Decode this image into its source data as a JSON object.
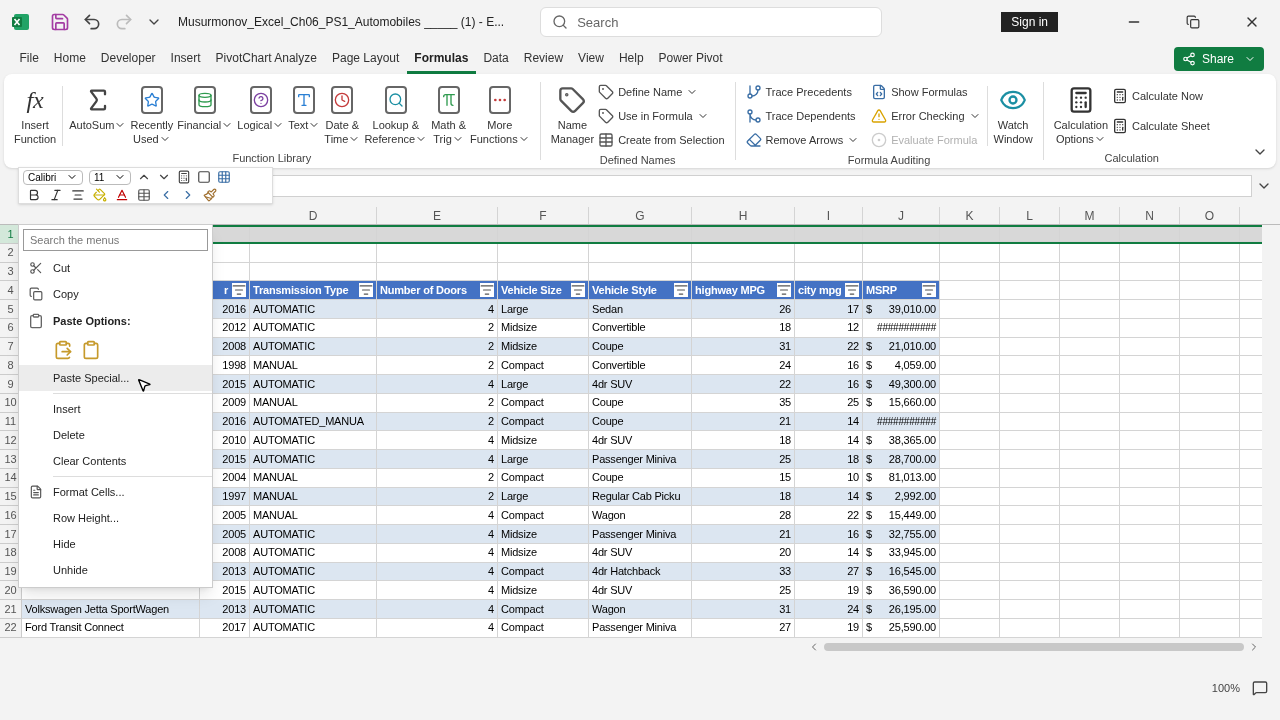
{
  "title_bar": {
    "file_title": "Musurmonov_Excel_Ch06_PS1_Automobiles _____ (1)  -  E...",
    "search_placeholder": "Search",
    "sign_in": "Sign in"
  },
  "menu_tabs": [
    {
      "label": "File",
      "selected": false
    },
    {
      "label": "Home",
      "selected": false
    },
    {
      "label": "Developer",
      "selected": false
    },
    {
      "label": "Insert",
      "selected": false
    },
    {
      "label": "PivotChart Analyze",
      "selected": false
    },
    {
      "label": "Page Layout",
      "selected": false
    },
    {
      "label": "Formulas",
      "selected": true
    },
    {
      "label": "Data",
      "selected": false
    },
    {
      "label": "Review",
      "selected": false
    },
    {
      "label": "View",
      "selected": false
    },
    {
      "label": "Help",
      "selected": false
    },
    {
      "label": "Power Pivot",
      "selected": false
    }
  ],
  "share": "Share",
  "function_library": {
    "label": "Function Library",
    "insert_function": {
      "icon_text": "fx",
      "lines": [
        "Insert",
        "Function"
      ]
    },
    "items": [
      {
        "lines": [
          "AutoSum"
        ],
        "has_menu": true
      },
      {
        "lines": [
          "Recently",
          "Used"
        ],
        "has_menu": true
      },
      {
        "lines": [
          "Financial"
        ],
        "has_menu": true
      },
      {
        "lines": [
          "Logical"
        ],
        "has_menu": true
      },
      {
        "lines": [
          "Text"
        ],
        "has_menu": true
      },
      {
        "lines": [
          "Date &",
          "Time"
        ],
        "has_menu": true
      },
      {
        "lines": [
          "Lookup &",
          "Reference"
        ],
        "has_menu": true
      },
      {
        "lines": [
          "Math &",
          "Trig"
        ],
        "has_menu": true
      },
      {
        "lines": [
          "More",
          "Functions"
        ],
        "has_menu": true
      }
    ]
  },
  "defined_names": {
    "label": "Defined Names",
    "big": {
      "lines": [
        "Name",
        "Manager"
      ]
    },
    "items": [
      {
        "label": "Define Name",
        "has_menu": true,
        "disabled": false
      },
      {
        "label": "Use in Formula",
        "has_menu": true,
        "disabled": false
      },
      {
        "label": "Create from Selection",
        "has_menu": false,
        "disabled": false
      }
    ]
  },
  "formula_auditing": {
    "label": "Formula Auditing",
    "items": [
      {
        "label": "Trace Precedents",
        "has_menu": false,
        "disabled": false
      },
      {
        "label": "Trace Dependents",
        "has_menu": false,
        "disabled": false
      },
      {
        "label": "Remove Arrows",
        "has_menu": true,
        "disabled": false
      },
      {
        "label": "Show Formulas",
        "has_menu": false,
        "disabled": false
      },
      {
        "label": "Error Checking",
        "has_menu": true,
        "disabled": false
      },
      {
        "label": "Evaluate Formula",
        "has_menu": false,
        "disabled": true
      }
    ],
    "watch": {
      "lines": [
        "Watch",
        "Window"
      ]
    }
  },
  "calculation": {
    "label": "Calculation",
    "big": {
      "lines": [
        "Calculation",
        "Options"
      ],
      "has_menu": true
    },
    "items": [
      {
        "label": "Calculate Now"
      },
      {
        "label": "Calculate Sheet"
      }
    ]
  },
  "mini_toolbar": {
    "font": "Calibri",
    "size": "11"
  },
  "context_menu": {
    "search_placeholder": "Search the menus",
    "items": [
      {
        "kind": "item",
        "label": "Cut",
        "highlighted": false
      },
      {
        "kind": "item",
        "label": "Copy",
        "highlighted": false
      },
      {
        "kind": "header",
        "label": "Paste Options:"
      },
      {
        "kind": "paste_icons"
      },
      {
        "kind": "item",
        "label": "Paste Special...",
        "highlighted": true
      },
      {
        "kind": "separator"
      },
      {
        "kind": "item",
        "label": "Insert",
        "highlighted": false
      },
      {
        "kind": "item",
        "label": "Delete",
        "highlighted": false
      },
      {
        "kind": "item",
        "label": "Clear Contents",
        "highlighted": false
      },
      {
        "kind": "separator"
      },
      {
        "kind": "item",
        "label": "Format Cells...",
        "highlighted": false
      },
      {
        "kind": "item",
        "label": "Row Height...",
        "highlighted": false
      },
      {
        "kind": "item",
        "label": "Hide",
        "highlighted": false
      },
      {
        "kind": "item",
        "label": "Unhide",
        "highlighted": false
      }
    ]
  },
  "columns": [
    "D",
    "E",
    "F",
    "G",
    "H",
    "I",
    "J",
    "K",
    "L",
    "M",
    "N",
    "O"
  ],
  "row_numbers": [
    "1",
    "2",
    "3",
    "4",
    "5",
    "6",
    "7",
    "8",
    "9",
    "10",
    "11",
    "12",
    "13",
    "14",
    "15",
    "16",
    "17",
    "18",
    "19",
    "20",
    "21",
    "22"
  ],
  "table_header": [
    "r",
    "Transmission Type",
    "Number of Doors",
    "Vehicle Size",
    "Vehicle Style",
    "highway MPG",
    "city mpg",
    "MSRP"
  ],
  "rows": [
    {
      "year": "2016",
      "transmission": "AUTOMATIC",
      "doors": "4",
      "size": "Large",
      "style": "Sedan",
      "hwy": "26",
      "city": "17",
      "msrp_symbol": "$",
      "msrp": "39,010.00"
    },
    {
      "year": "2012",
      "transmission": "AUTOMATIC",
      "doors": "2",
      "size": "Midsize",
      "style": "Convertible",
      "hwy": "18",
      "city": "12",
      "msrp": "###########"
    },
    {
      "year": "2008",
      "transmission": "AUTOMATIC",
      "doors": "2",
      "size": "Midsize",
      "style": "Coupe",
      "hwy": "31",
      "city": "22",
      "msrp_symbol": "$",
      "msrp": "21,010.00"
    },
    {
      "year": "1998",
      "transmission": "MANUAL",
      "doors": "2",
      "size": "Compact",
      "style": "Convertible",
      "hwy": "24",
      "city": "16",
      "msrp_symbol": "$",
      "msrp": "4,059.00"
    },
    {
      "year": "2015",
      "transmission": "AUTOMATIC",
      "doors": "4",
      "size": "Large",
      "style": "4dr SUV",
      "hwy": "22",
      "city": "16",
      "msrp_symbol": "$",
      "msrp": "49,300.00"
    },
    {
      "year": "2009",
      "transmission": "MANUAL",
      "doors": "2",
      "size": "Compact",
      "style": "Coupe",
      "hwy": "35",
      "city": "25",
      "msrp_symbol": "$",
      "msrp": "15,660.00"
    },
    {
      "year": "2016",
      "transmission": "AUTOMATED_MANUA",
      "doors": "2",
      "size": "Compact",
      "style": "Coupe",
      "hwy": "21",
      "city": "14",
      "msrp": "###########"
    },
    {
      "year": "2010",
      "transmission": "AUTOMATIC",
      "doors": "4",
      "size": "Midsize",
      "style": "4dr SUV",
      "hwy": "18",
      "city": "14",
      "msrp_symbol": "$",
      "msrp": "38,365.00"
    },
    {
      "year": "2015",
      "transmission": "AUTOMATIC",
      "doors": "4",
      "size": "Large",
      "style": "Passenger Miniva",
      "hwy": "25",
      "city": "18",
      "msrp_symbol": "$",
      "msrp": "28,700.00"
    },
    {
      "year": "2004",
      "transmission": "MANUAL",
      "doors": "2",
      "size": "Compact",
      "style": "Coupe",
      "hwy": "15",
      "city": "10",
      "msrp_symbol": "$",
      "msrp": "81,013.00"
    },
    {
      "year": "1997",
      "transmission": "MANUAL",
      "doors": "2",
      "size": "Large",
      "style": "Regular Cab Picku",
      "hwy": "18",
      "city": "14",
      "msrp_symbol": "$",
      "msrp": "2,992.00"
    },
    {
      "year": "2005",
      "transmission": "MANUAL",
      "doors": "4",
      "size": "Compact",
      "style": "Wagon",
      "hwy": "28",
      "city": "22",
      "msrp_symbol": "$",
      "msrp": "15,449.00"
    },
    {
      "year": "2005",
      "transmission": "AUTOMATIC",
      "doors": "4",
      "size": "Midsize",
      "style": "Passenger Miniva",
      "hwy": "21",
      "city": "16",
      "msrp_symbol": "$",
      "msrp": "32,755.00"
    },
    {
      "year": "2008",
      "transmission": "AUTOMATIC",
      "doors": "4",
      "size": "Midsize",
      "style": "4dr SUV",
      "hwy": "20",
      "city": "14",
      "msrp_symbol": "$",
      "msrp": "33,945.00"
    },
    {
      "year": "2013",
      "transmission": "AUTOMATIC",
      "doors": "4",
      "size": "Compact",
      "style": "4dr Hatchback",
      "hwy": "33",
      "city": "27",
      "msrp_symbol": "$",
      "msrp": "16,545.00"
    },
    {
      "year": "2015",
      "transmission": "AUTOMATIC",
      "doors": "4",
      "size": "Midsize",
      "style": "4dr SUV",
      "hwy": "25",
      "city": "19",
      "msrp_symbol": "$",
      "msrp": "36,590.00"
    },
    {
      "model": "Volkswagen Jetta SportWagen",
      "year": "2013",
      "transmission": "AUTOMATIC",
      "doors": "4",
      "size": "Compact",
      "style": "Wagon",
      "hwy": "31",
      "city": "24",
      "msrp_symbol": "$",
      "msrp": "26,195.00"
    },
    {
      "model": "Ford Transit Connect",
      "year": "2017",
      "transmission": "AUTOMATIC",
      "doors": "4",
      "size": "Compact",
      "style": "Passenger Miniva",
      "hwy": "27",
      "city": "19",
      "msrp_symbol": "$",
      "msrp": "25,590.00"
    }
  ],
  "status_bar": {
    "zoom": "100%"
  }
}
